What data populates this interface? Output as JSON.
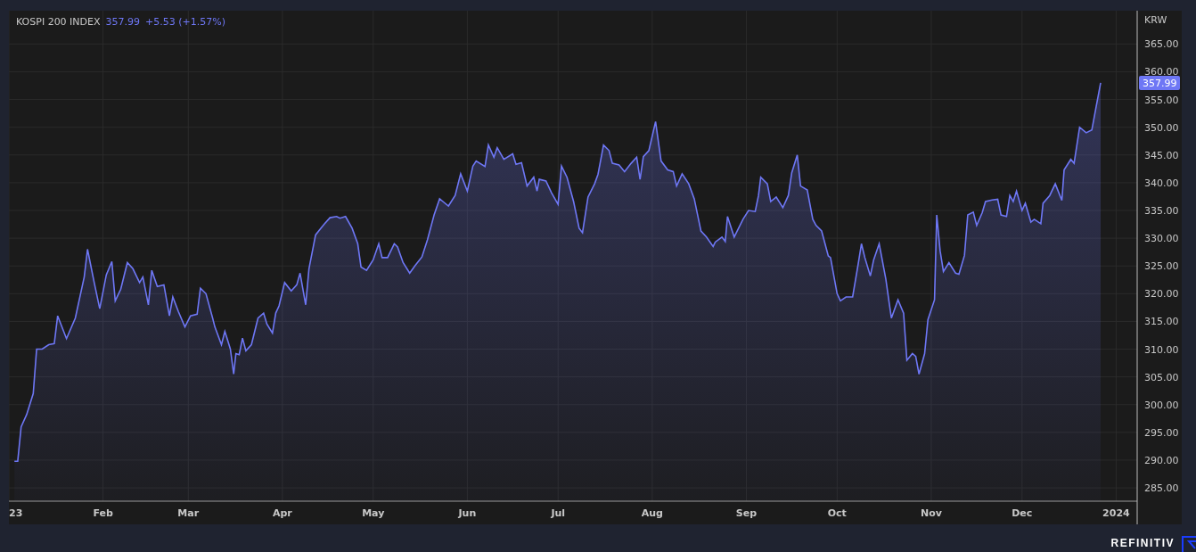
{
  "header": {
    "last": "357.99",
    "change": "+5.53 (+1.57%)"
  },
  "chart_data": {
    "type": "area",
    "grid": true,
    "ylabel": "KRW",
    "xlim": [
      2023,
      2024.019
    ],
    "ylim": [
      282.6,
      371
    ],
    "xticks": [
      {
        "value": 2023,
        "label": "23"
      },
      {
        "value": 2023.085,
        "label": "Feb"
      },
      {
        "value": 2023.162,
        "label": "Mar"
      },
      {
        "value": 2023.247,
        "label": "Apr"
      },
      {
        "value": 2023.329,
        "label": "May"
      },
      {
        "value": 2023.414,
        "label": "Jun"
      },
      {
        "value": 2023.496,
        "label": "Jul"
      },
      {
        "value": 2023.581,
        "label": "Aug"
      },
      {
        "value": 2023.666,
        "label": "Sep"
      },
      {
        "value": 2023.748,
        "label": "Oct"
      },
      {
        "value": 2023.833,
        "label": "Nov"
      },
      {
        "value": 2023.915,
        "label": "Dec"
      },
      {
        "value": 2024,
        "label": "2024"
      }
    ],
    "yticks": [
      {
        "value": 285,
        "label": "285.00"
      },
      {
        "value": 290,
        "label": "290.00"
      },
      {
        "value": 295,
        "label": "295.00"
      },
      {
        "value": 300,
        "label": "300.00"
      },
      {
        "value": 305,
        "label": "305.00"
      },
      {
        "value": 310,
        "label": "310.00"
      },
      {
        "value": 315,
        "label": "315.00"
      },
      {
        "value": 320,
        "label": "320.00"
      },
      {
        "value": 325,
        "label": "325.00"
      },
      {
        "value": 330,
        "label": "330.00"
      },
      {
        "value": 335,
        "label": "335.00"
      },
      {
        "value": 340,
        "label": "340.00"
      },
      {
        "value": 345,
        "label": "345.00"
      },
      {
        "value": 350,
        "label": "350.00"
      },
      {
        "value": 355,
        "label": "355.00"
      },
      {
        "value": 360,
        "label": "360.00"
      },
      {
        "value": 365,
        "label": "365.00"
      }
    ],
    "x": [
      2023.005,
      2023.008,
      2023.011,
      2023.016,
      2023.022,
      2023.025,
      2023.03,
      2023.036,
      2023.041,
      2023.044,
      2023.052,
      2023.06,
      2023.068,
      2023.071,
      2023.077,
      2023.082,
      2023.088,
      2023.093,
      2023.096,
      2023.101,
      2023.107,
      2023.112,
      2023.118,
      2023.121,
      2023.126,
      2023.129,
      2023.134,
      2023.14,
      2023.145,
      2023.148,
      2023.153,
      2023.159,
      2023.164,
      2023.17,
      2023.173,
      2023.178,
      2023.184,
      2023.186,
      2023.192,
      2023.195,
      2023.2,
      2023.203,
      2023.205,
      2023.208,
      2023.211,
      2023.214,
      2023.219,
      2023.225,
      2023.23,
      2023.233,
      2023.238,
      2023.241,
      2023.244,
      2023.249,
      2023.255,
      2023.26,
      2023.263,
      2023.268,
      2023.271,
      2023.277,
      2023.285,
      2023.29,
      2023.296,
      2023.299,
      2023.304,
      2023.31,
      2023.315,
      2023.318,
      2023.323,
      2023.329,
      2023.334,
      2023.337,
      2023.342,
      2023.348,
      2023.351,
      2023.356,
      2023.362,
      2023.367,
      2023.373,
      2023.378,
      2023.384,
      2023.389,
      2023.392,
      2023.397,
      2023.403,
      2023.408,
      2023.414,
      2023.419,
      2023.422,
      2023.43,
      2023.433,
      2023.438,
      2023.441,
      2023.447,
      2023.455,
      2023.458,
      2023.463,
      2023.468,
      2023.474,
      2023.477,
      2023.479,
      2023.485,
      2023.49,
      2023.496,
      2023.499,
      2023.504,
      2023.51,
      2023.515,
      2023.518,
      2023.523,
      2023.529,
      2023.532,
      2023.537,
      2023.542,
      2023.545,
      2023.551,
      2023.556,
      2023.562,
      2023.567,
      2023.57,
      2023.573,
      2023.578,
      2023.584,
      2023.589,
      2023.595,
      2023.6,
      2023.603,
      2023.608,
      2023.614,
      2023.619,
      2023.625,
      2023.63,
      2023.636,
      2023.638,
      2023.644,
      2023.647,
      2023.649,
      2023.655,
      2023.663,
      2023.668,
      2023.674,
      2023.677,
      2023.679,
      2023.685,
      2023.688,
      2023.693,
      2023.699,
      2023.704,
      2023.707,
      2023.712,
      2023.715,
      2023.721,
      2023.726,
      2023.729,
      2023.734,
      2023.74,
      2023.742,
      2023.748,
      2023.751,
      2023.756,
      2023.762,
      2023.767,
      2023.77,
      2023.773,
      2023.778,
      2023.781,
      2023.786,
      2023.792,
      2023.795,
      2023.797,
      2023.803,
      2023.808,
      2023.811,
      2023.816,
      2023.819,
      2023.822,
      2023.827,
      2023.83,
      2023.836,
      2023.838,
      2023.841,
      2023.844,
      2023.849,
      2023.855,
      2023.858,
      2023.863,
      2023.866,
      2023.871,
      2023.874,
      2023.879,
      2023.882,
      2023.888,
      2023.893,
      2023.896,
      2023.901,
      2023.904,
      2023.907,
      2023.91,
      2023.915,
      2023.918,
      2023.923,
      2023.926,
      2023.932,
      2023.934,
      2023.94,
      2023.945,
      2023.951,
      2023.953,
      2023.959,
      2023.962,
      2023.967,
      2023.973,
      2023.978,
      2023.981,
      2023.986
    ],
    "series": [
      {
        "name": "KOSPI 200 INDEX",
        "color": "#6e77f5",
        "values": [
          289.8,
          289.8,
          296,
          298.2,
          302,
          310,
          310,
          310.8,
          311,
          316,
          311.9,
          315.6,
          323,
          328,
          322,
          317.3,
          323.4,
          325.8,
          318.7,
          320.8,
          325.6,
          324.5,
          322,
          323,
          318,
          324.2,
          321.3,
          321.6,
          316,
          319.4,
          316.8,
          314,
          316,
          316.3,
          321,
          320,
          315.6,
          314,
          310.8,
          313.2,
          310,
          305.5,
          309.2,
          309,
          312,
          309.7,
          310.8,
          315.6,
          316.5,
          314.5,
          312.9,
          316.5,
          317.8,
          322,
          320.5,
          321.6,
          323.7,
          318,
          324.5,
          330.6,
          332.6,
          333.7,
          333.9,
          333.6,
          333.9,
          331.8,
          329,
          324.8,
          324.2,
          326.1,
          329,
          326.5,
          326.5,
          329,
          328.4,
          325.6,
          323.7,
          325.1,
          326.6,
          329.7,
          334.2,
          337.1,
          336.6,
          335.8,
          337.7,
          341.6,
          338.5,
          343,
          343.9,
          342.9,
          346.8,
          344.6,
          346.3,
          344.2,
          345.2,
          343.3,
          343.6,
          339.4,
          341,
          338.5,
          340.6,
          340.3,
          338.2,
          336.1,
          343,
          341,
          336.6,
          331.8,
          331,
          337.4,
          339.8,
          341.5,
          346.8,
          345.8,
          343.5,
          343.2,
          342,
          343.5,
          344.6,
          340.6,
          344.7,
          345.8,
          351,
          343.9,
          342.3,
          342,
          339.4,
          341.6,
          339.8,
          337.1,
          331.3,
          330.2,
          328.5,
          329.3,
          330.2,
          329.4,
          333.9,
          330.2,
          333.4,
          335,
          334.8,
          337.7,
          341,
          339.8,
          336.6,
          337.4,
          335.5,
          337.7,
          341.8,
          345,
          339.4,
          338.7,
          333.4,
          332.3,
          331.3,
          326.8,
          326.5,
          320,
          318.7,
          319.4,
          319.4,
          325.3,
          329,
          326.5,
          323.2,
          326.1,
          329,
          322.6,
          318.4,
          315.6,
          318.9,
          316.5,
          308,
          309.2,
          308.7,
          305.5,
          309.2,
          315.3,
          318.9,
          334.2,
          327.7,
          324,
          325.6,
          323.7,
          323.5,
          326.9,
          334.2,
          334.7,
          332.3,
          334.6,
          336.6,
          336.9,
          337,
          334.2,
          333.9,
          337.7,
          336.6,
          338.5,
          335,
          336.3,
          332.9,
          333.4,
          332.6,
          336.3,
          337.7,
          339.8,
          336.8,
          342.3,
          344.2,
          343.5,
          350,
          349,
          349.5,
          352.7,
          358
        ]
      }
    ]
  },
  "last_price_tag": "357.99",
  "brand": "REFINITIV"
}
